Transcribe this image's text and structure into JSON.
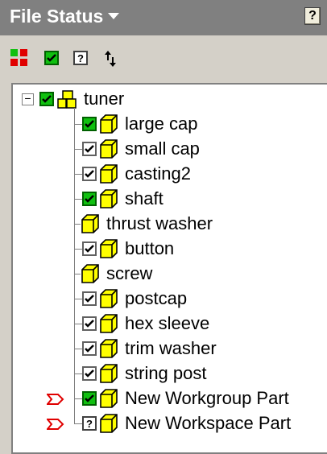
{
  "header": {
    "title": "File Status",
    "help_glyph": "?"
  },
  "toolbar": {
    "buttons": [
      {
        "name": "show-status-toggle",
        "icon": "status-grid-icon"
      },
      {
        "name": "check-all",
        "icon": "green-check-icon"
      },
      {
        "name": "unknown-status",
        "icon": "question-mark-icon"
      },
      {
        "name": "refresh",
        "icon": "refresh-arrows-icon"
      }
    ],
    "unknown_glyph": "?"
  },
  "tree": {
    "root": {
      "label": "tuner",
      "expander": "−",
      "checkbox": "green",
      "icon": "assembly-icon"
    },
    "items": [
      {
        "label": "large cap",
        "checkbox": "green",
        "marker": false
      },
      {
        "label": "small cap",
        "checkbox": "check",
        "marker": false
      },
      {
        "label": "casting2",
        "checkbox": "check",
        "marker": false
      },
      {
        "label": "shaft",
        "checkbox": "green",
        "marker": false
      },
      {
        "label": "thrust washer",
        "checkbox": "none",
        "marker": false
      },
      {
        "label": "button",
        "checkbox": "check",
        "marker": false
      },
      {
        "label": "screw",
        "checkbox": "none",
        "marker": false
      },
      {
        "label": "postcap",
        "checkbox": "check",
        "marker": false
      },
      {
        "label": "hex sleeve",
        "checkbox": "check",
        "marker": false
      },
      {
        "label": "trim washer",
        "checkbox": "check",
        "marker": false
      },
      {
        "label": "string post",
        "checkbox": "check",
        "marker": false
      },
      {
        "label": "New Workgroup Part",
        "checkbox": "green",
        "marker": true
      },
      {
        "label": "New Workspace Part",
        "checkbox": "question",
        "marker": true
      }
    ]
  },
  "colors": {
    "title_bar": "#808080",
    "part_yellow": "#ffff00",
    "status_green": "#10c010",
    "marker_red": "#e00000"
  }
}
